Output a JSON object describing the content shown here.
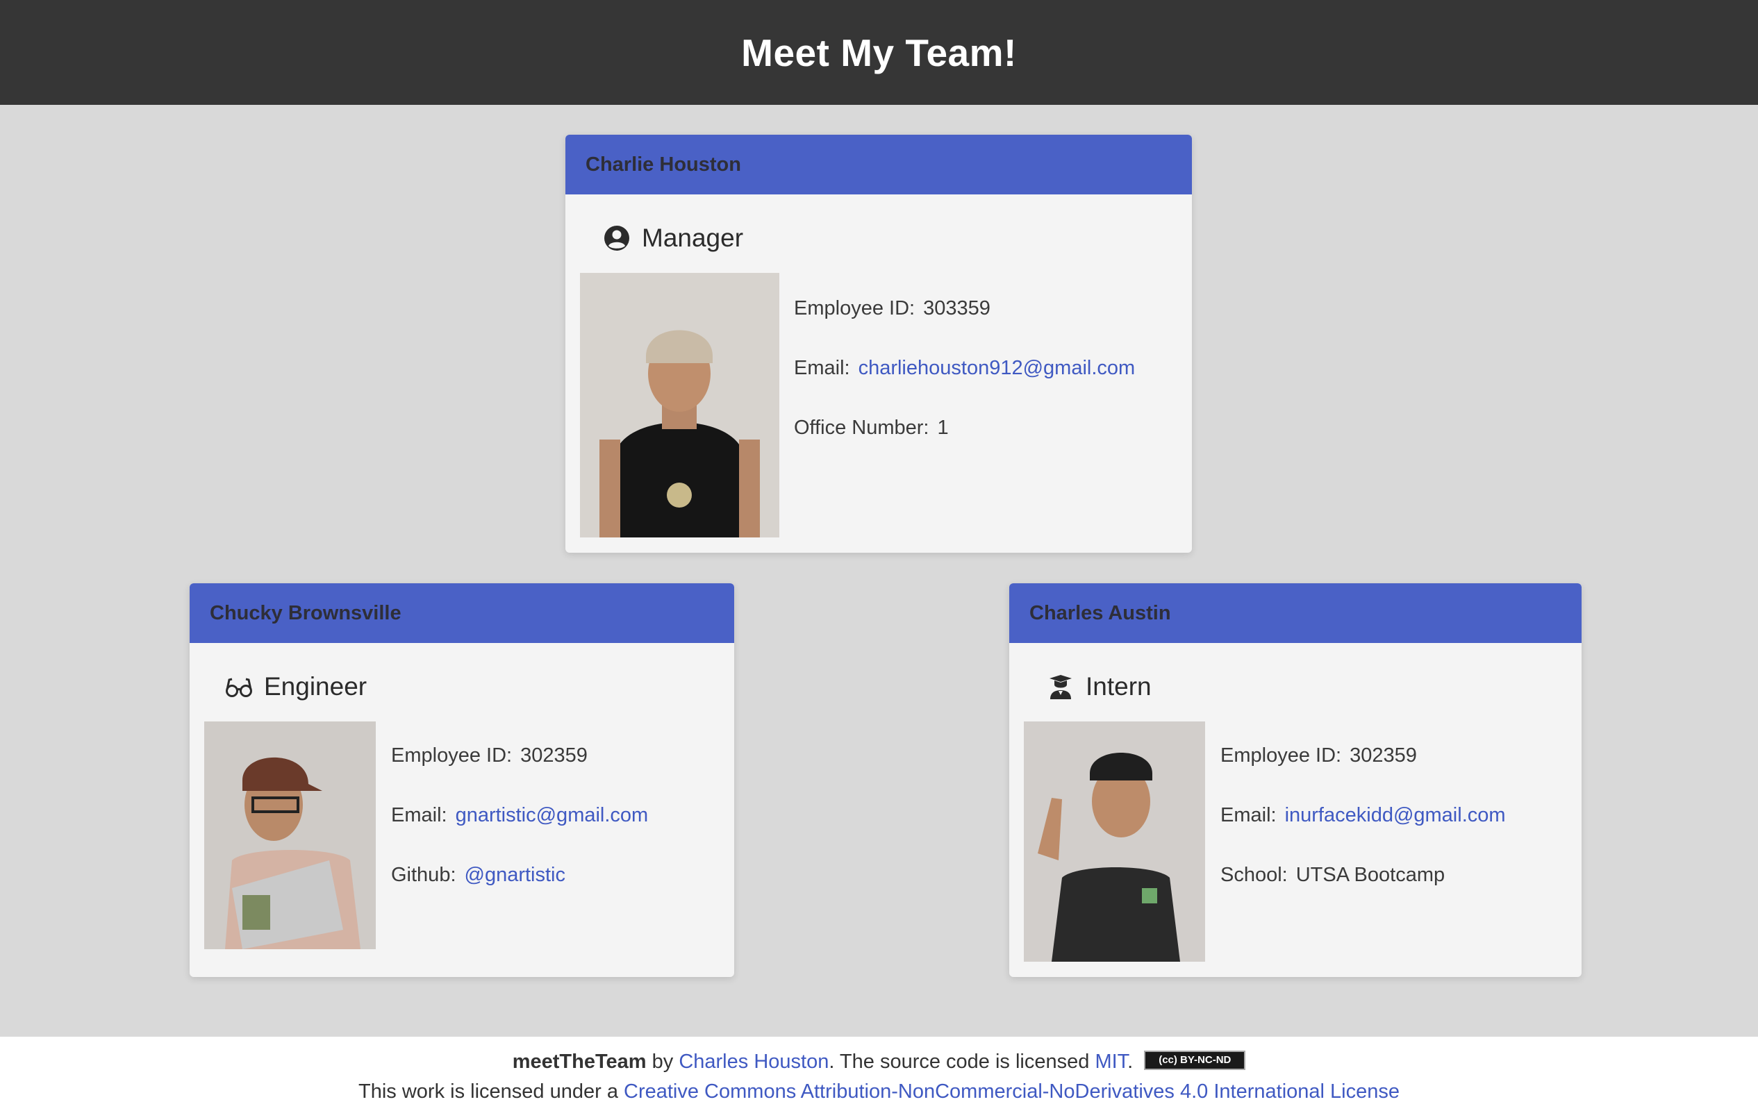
{
  "header": {
    "title": "Meet My Team!"
  },
  "manager": {
    "name": "Charlie Houston",
    "role": "Manager",
    "role_icon": "user-circle-icon",
    "id_label": "Employee ID:",
    "id": "303359",
    "email_label": "Email:",
    "email": "charliehouston912@gmail.com",
    "extra_label": "Office Number:",
    "extra": "1"
  },
  "engineer": {
    "name": "Chucky Brownsville",
    "role": "Engineer",
    "role_icon": "glasses-icon",
    "id_label": "Employee ID:",
    "id": "302359",
    "email_label": "Email:",
    "email": "gnartistic@gmail.com",
    "extra_label": "Github:",
    "extra": "@gnartistic"
  },
  "intern": {
    "name": "Charles Austin",
    "role": "Intern",
    "role_icon": "graduate-icon",
    "id_label": "Employee ID:",
    "id": "302359",
    "email_label": "Email:",
    "email": "inurfacekidd@gmail.com",
    "extra_label": "School:",
    "extra": "UTSA Bootcamp"
  },
  "footer": {
    "project": "meetTheTeam",
    "by": "by",
    "author": "Charles Houston",
    "licensed_text": ". The source code is licensed",
    "license": "MIT",
    "period": ".",
    "badge_text": "(cc) BY-NC-ND",
    "line2_prefix": "This work is licensed under a",
    "line2_link": "Creative Commons Attribution-NonCommercial-NoDerivatives 4.0 International License"
  },
  "colors": {
    "header_bg": "#363636",
    "card_head": "#4a61c6",
    "link": "#3f59c2",
    "page_bg": "#d9d9d9"
  }
}
